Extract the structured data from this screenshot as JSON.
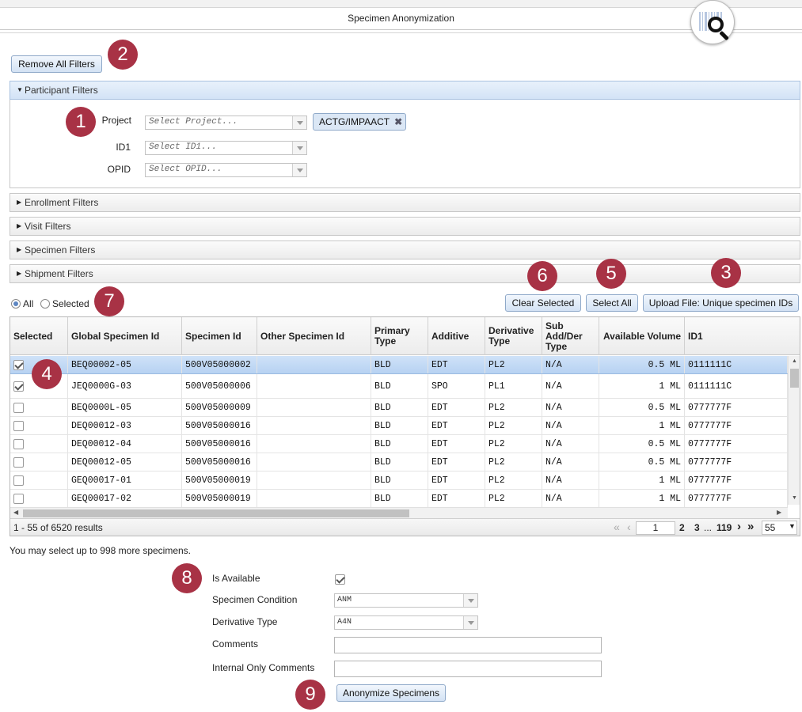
{
  "header": {
    "title": "Specimen Anonymization"
  },
  "toolbar": {
    "remove_filters_label": "Remove All Filters"
  },
  "participant_filters": {
    "label": "Participant Filters",
    "project": {
      "label": "Project",
      "placeholder": "Select Project...",
      "selected_tag": "ACTG/IMPAACT"
    },
    "id1": {
      "label": "ID1",
      "placeholder": "Select ID1..."
    },
    "opid": {
      "label": "OPID",
      "placeholder": "Select OPID..."
    }
  },
  "filter_sections": [
    "Enrollment Filters",
    "Visit Filters",
    "Specimen Filters",
    "Shipment Filters"
  ],
  "view_toggle": {
    "all_label": "All",
    "selected_label": "Selected",
    "current": "All"
  },
  "actions": {
    "clear_selected": "Clear Selected",
    "select_all": "Select All",
    "upload_file": "Upload File: Unique specimen IDs"
  },
  "grid": {
    "columns": [
      "Selected",
      "Global Specimen Id",
      "Specimen Id",
      "Other Specimen Id",
      "Primary Type",
      "Additive",
      "Derivative Type",
      "Sub Add/Der Type",
      "Available Volume",
      "ID1"
    ],
    "rows": [
      {
        "selected": true,
        "global_id": "BEQ00002-05",
        "specimen_id": "500V05000002",
        "other_id": "",
        "primary": "BLD",
        "additive": "EDT",
        "derivative": "PL2",
        "sub": "N/A",
        "volume": "0.5 ML",
        "id1": "0111111C"
      },
      {
        "selected": true,
        "global_id": "JEQ0000G-03",
        "specimen_id": "500V05000006",
        "other_id": "",
        "primary": "BLD",
        "additive": "SPO",
        "derivative": "PL1",
        "sub": "N/A",
        "volume": "1 ML",
        "id1": "0111111C"
      },
      {
        "selected": false,
        "global_id": "BEQ0000L-05",
        "specimen_id": "500V05000009",
        "other_id": "",
        "primary": "BLD",
        "additive": "EDT",
        "derivative": "PL2",
        "sub": "N/A",
        "volume": "0.5 ML",
        "id1": "0777777F"
      },
      {
        "selected": false,
        "global_id": "DEQ00012-03",
        "specimen_id": "500V05000016",
        "other_id": "",
        "primary": "BLD",
        "additive": "EDT",
        "derivative": "PL2",
        "sub": "N/A",
        "volume": "1 ML",
        "id1": "0777777F"
      },
      {
        "selected": false,
        "global_id": "DEQ00012-04",
        "specimen_id": "500V05000016",
        "other_id": "",
        "primary": "BLD",
        "additive": "EDT",
        "derivative": "PL2",
        "sub": "N/A",
        "volume": "0.5 ML",
        "id1": "0777777F"
      },
      {
        "selected": false,
        "global_id": "DEQ00012-05",
        "specimen_id": "500V05000016",
        "other_id": "",
        "primary": "BLD",
        "additive": "EDT",
        "derivative": "PL2",
        "sub": "N/A",
        "volume": "0.5 ML",
        "id1": "0777777F"
      },
      {
        "selected": false,
        "global_id": "GEQ00017-01",
        "specimen_id": "500V05000019",
        "other_id": "",
        "primary": "BLD",
        "additive": "EDT",
        "derivative": "PL2",
        "sub": "N/A",
        "volume": "1 ML",
        "id1": "0777777F"
      },
      {
        "selected": false,
        "global_id": "GEQ00017-02",
        "specimen_id": "500V05000019",
        "other_id": "",
        "primary": "BLD",
        "additive": "EDT",
        "derivative": "PL2",
        "sub": "N/A",
        "volume": "1 ML",
        "id1": "0777777F"
      }
    ],
    "footer": {
      "results": "1 - 55 of 6520 results",
      "first": "«",
      "prev": "‹",
      "page_input": "1",
      "pages": [
        "2",
        "3",
        "...",
        "119"
      ],
      "next": "›",
      "last": "»",
      "page_size": "55"
    }
  },
  "selection_note": "You may select up to 998 more specimens.",
  "anonymize_form": {
    "is_available_label": "Is Available",
    "is_available_checked": true,
    "condition_label": "Specimen Condition",
    "condition_value": "ANM",
    "derivative_label": "Derivative Type",
    "derivative_value": "A4N",
    "comments_label": "Comments",
    "comments_value": "",
    "internal_label": "Internal Only Comments",
    "internal_value": "",
    "submit_label": "Anonymize Specimens"
  },
  "markers": [
    "1",
    "2",
    "3",
    "4",
    "5",
    "6",
    "7",
    "8",
    "9"
  ],
  "colors": {
    "marker": "#a83245",
    "selected_row": "#b7d2f2",
    "button": "#d3e2f4"
  }
}
